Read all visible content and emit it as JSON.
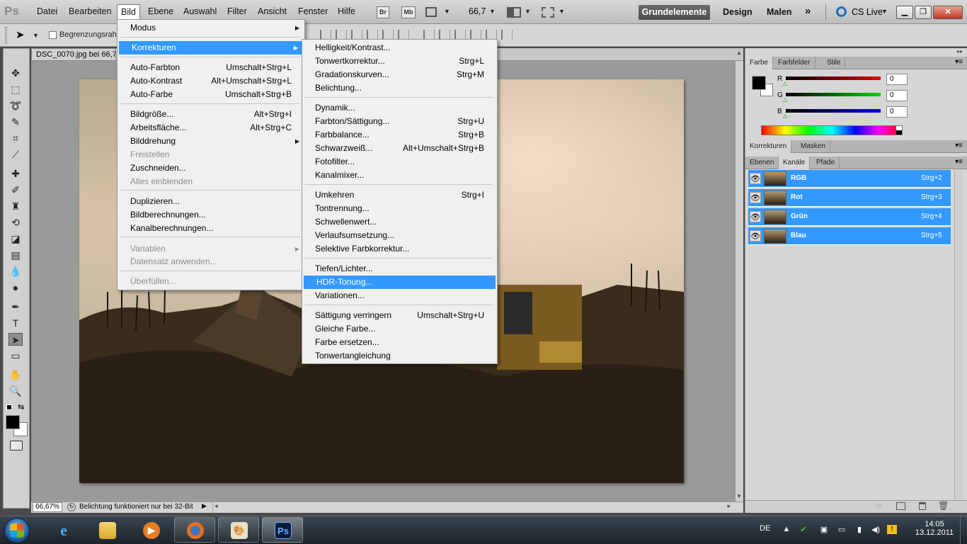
{
  "app": {
    "logo": "Ps"
  },
  "menubar": {
    "items": [
      "Datei",
      "Bearbeiten",
      "Bild",
      "Ebene",
      "Auswahl",
      "Filter",
      "Ansicht",
      "Fenster",
      "Hilfe"
    ],
    "active": "Bild",
    "bridge": "Br",
    "minibridge": "Mb",
    "zoom": "66,7",
    "workspaces": [
      "Grundelemente",
      "Design",
      "Malen"
    ],
    "more": "»",
    "cslive": "CS Live"
  },
  "options": {
    "begrenzung": "Begrenzungsrahmen"
  },
  "document": {
    "tab_title": "DSC_0070.jpg bei 66,7"
  },
  "status": {
    "zoom": "66,67%",
    "message": "Belichtung funktioniert nur bei 32-Bit"
  },
  "bild_menu": {
    "items": [
      {
        "label": "Modus",
        "submenu": true
      },
      {
        "label": "Korrekturen",
        "submenu": true,
        "highlight": true
      },
      {
        "label": "Auto-Farbton",
        "shortcut": "Umschalt+Strg+L"
      },
      {
        "label": "Auto-Kontrast",
        "shortcut": "Alt+Umschalt+Strg+L"
      },
      {
        "label": "Auto-Farbe",
        "shortcut": "Umschalt+Strg+B"
      },
      {
        "label": "Bildgröße...",
        "shortcut": "Alt+Strg+I"
      },
      {
        "label": "Arbeitsfläche...",
        "shortcut": "Alt+Strg+C"
      },
      {
        "label": "Bilddrehung",
        "submenu": true
      },
      {
        "label": "Freistellen",
        "disabled": true
      },
      {
        "label": "Zuschneiden..."
      },
      {
        "label": "Alles einblenden",
        "disabled": true
      },
      {
        "label": "Duplizieren..."
      },
      {
        "label": "Bildberechnungen..."
      },
      {
        "label": "Kanalberechnungen..."
      },
      {
        "label": "Variablen",
        "submenu": true,
        "disabled": true
      },
      {
        "label": "Datensatz anwenden...",
        "disabled": true
      },
      {
        "label": "Überfüllen...",
        "disabled": true
      }
    ]
  },
  "korrekturen_menu": {
    "items": [
      {
        "label": "Helligkeit/Kontrast..."
      },
      {
        "label": "Tonwertkorrektur...",
        "shortcut": "Strg+L"
      },
      {
        "label": "Gradationskurven...",
        "shortcut": "Strg+M"
      },
      {
        "label": "Belichtung..."
      },
      {
        "label": "Dynamik..."
      },
      {
        "label": "Farbton/Sättigung...",
        "shortcut": "Strg+U"
      },
      {
        "label": "Farbbalance...",
        "shortcut": "Strg+B"
      },
      {
        "label": "Schwarzweiß...",
        "shortcut": "Alt+Umschalt+Strg+B"
      },
      {
        "label": "Fotofilter..."
      },
      {
        "label": "Kanalmixer..."
      },
      {
        "label": "Umkehren",
        "shortcut": "Strg+I"
      },
      {
        "label": "Tontrennung..."
      },
      {
        "label": "Schwellenwert..."
      },
      {
        "label": "Verlaufsumsetzung..."
      },
      {
        "label": "Selektive Farbkorrektur..."
      },
      {
        "label": "Tiefen/Lichter..."
      },
      {
        "label": "HDR-Tonung...",
        "highlight": true
      },
      {
        "label": "Variationen..."
      },
      {
        "label": "Sättigung verringern",
        "shortcut": "Umschalt+Strg+U"
      },
      {
        "label": "Gleiche Farbe..."
      },
      {
        "label": "Farbe ersetzen..."
      },
      {
        "label": "Tonwertangleichung"
      }
    ]
  },
  "color_panel": {
    "tabs": [
      "Farbe",
      "Farbfelder",
      "Stile"
    ],
    "channels": [
      {
        "label": "R",
        "value": "0",
        "color": "#cc0000"
      },
      {
        "label": "G",
        "value": "0",
        "color": "#00aa00"
      },
      {
        "label": "B",
        "value": "0",
        "color": "#0000cc"
      }
    ]
  },
  "adjust_panel": {
    "tabs": [
      "Korrekturen",
      "Masken"
    ]
  },
  "channels_panel": {
    "tabs": [
      "Ebenen",
      "Kanäle",
      "Pfade"
    ],
    "rows": [
      {
        "name": "RGB",
        "shortcut": "Strg+2"
      },
      {
        "name": "Rot",
        "shortcut": "Strg+3"
      },
      {
        "name": "Grün",
        "shortcut": "Strg+4"
      },
      {
        "name": "Blau",
        "shortcut": "Strg+5"
      }
    ]
  },
  "taskbar": {
    "lang": "DE",
    "time": "14:05",
    "date": "13.12.2011",
    "ps_label": "Ps"
  }
}
